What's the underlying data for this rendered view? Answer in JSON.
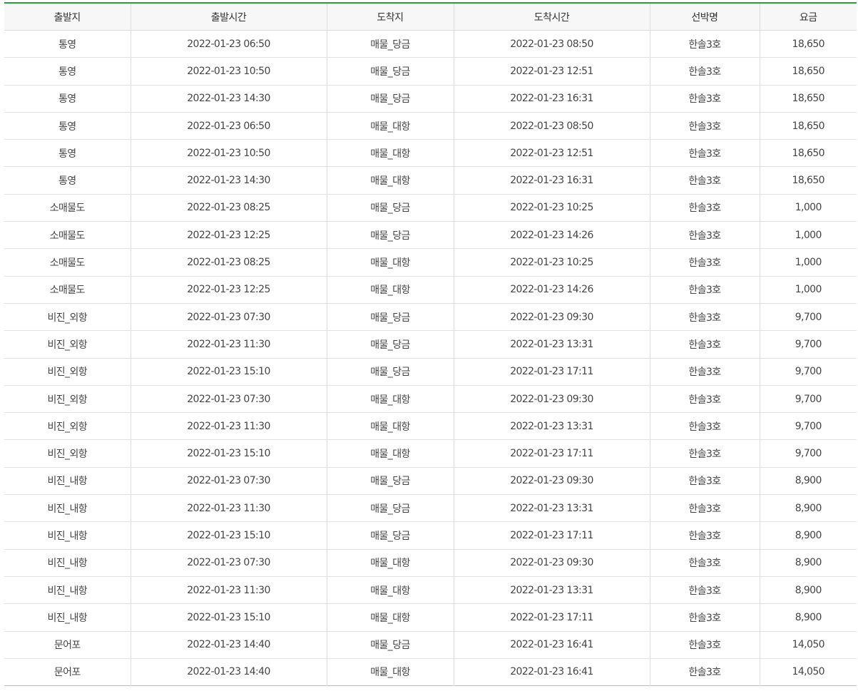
{
  "colors": {
    "accent_top_border": "#2e9b3c",
    "header_background": "#f7f7f7",
    "grid_line": "#dcdcdc"
  },
  "table": {
    "headers": [
      "출발지",
      "출발시간",
      "도착지",
      "도착시간",
      "선박명",
      "요금"
    ],
    "rows": [
      [
        "통영",
        "2022-01-23 06:50",
        "매물_당금",
        "2022-01-23 08:50",
        "한솔3호",
        "18,650"
      ],
      [
        "통영",
        "2022-01-23 10:50",
        "매물_당금",
        "2022-01-23 12:51",
        "한솔3호",
        "18,650"
      ],
      [
        "통영",
        "2022-01-23 14:30",
        "매물_당금",
        "2022-01-23 16:31",
        "한솔3호",
        "18,650"
      ],
      [
        "통영",
        "2022-01-23 06:50",
        "매물_대항",
        "2022-01-23 08:50",
        "한솔3호",
        "18,650"
      ],
      [
        "통영",
        "2022-01-23 10:50",
        "매물_대항",
        "2022-01-23 12:51",
        "한솔3호",
        "18,650"
      ],
      [
        "통영",
        "2022-01-23 14:30",
        "매물_대항",
        "2022-01-23 16:31",
        "한솔3호",
        "18,650"
      ],
      [
        "소매물도",
        "2022-01-23 08:25",
        "매물_당금",
        "2022-01-23 10:25",
        "한솔3호",
        "1,000"
      ],
      [
        "소매물도",
        "2022-01-23 12:25",
        "매물_당금",
        "2022-01-23 14:26",
        "한솔3호",
        "1,000"
      ],
      [
        "소매물도",
        "2022-01-23 08:25",
        "매물_대항",
        "2022-01-23 10:25",
        "한솔3호",
        "1,000"
      ],
      [
        "소매물도",
        "2022-01-23 12:25",
        "매물_대항",
        "2022-01-23 14:26",
        "한솔3호",
        "1,000"
      ],
      [
        "비진_외항",
        "2022-01-23 07:30",
        "매물_당금",
        "2022-01-23 09:30",
        "한솔3호",
        "9,700"
      ],
      [
        "비진_외항",
        "2022-01-23 11:30",
        "매물_당금",
        "2022-01-23 13:31",
        "한솔3호",
        "9,700"
      ],
      [
        "비진_외항",
        "2022-01-23 15:10",
        "매물_당금",
        "2022-01-23 17:11",
        "한솔3호",
        "9,700"
      ],
      [
        "비진_외항",
        "2022-01-23 07:30",
        "매물_대항",
        "2022-01-23 09:30",
        "한솔3호",
        "9,700"
      ],
      [
        "비진_외항",
        "2022-01-23 11:30",
        "매물_대항",
        "2022-01-23 13:31",
        "한솔3호",
        "9,700"
      ],
      [
        "비진_외항",
        "2022-01-23 15:10",
        "매물_대항",
        "2022-01-23 17:11",
        "한솔3호",
        "9,700"
      ],
      [
        "비진_내항",
        "2022-01-23 07:30",
        "매물_당금",
        "2022-01-23 09:30",
        "한솔3호",
        "8,900"
      ],
      [
        "비진_내항",
        "2022-01-23 11:30",
        "매물_당금",
        "2022-01-23 13:31",
        "한솔3호",
        "8,900"
      ],
      [
        "비진_내항",
        "2022-01-23 15:10",
        "매물_당금",
        "2022-01-23 17:11",
        "한솔3호",
        "8,900"
      ],
      [
        "비진_내항",
        "2022-01-23 07:30",
        "매물_대항",
        "2022-01-23 09:30",
        "한솔3호",
        "8,900"
      ],
      [
        "비진_내항",
        "2022-01-23 11:30",
        "매물_대항",
        "2022-01-23 13:31",
        "한솔3호",
        "8,900"
      ],
      [
        "비진_내항",
        "2022-01-23 15:10",
        "매물_대항",
        "2022-01-23 17:11",
        "한솔3호",
        "8,900"
      ],
      [
        "문어포",
        "2022-01-23 14:40",
        "매물_당금",
        "2022-01-23 16:41",
        "한솔3호",
        "14,050"
      ],
      [
        "문어포",
        "2022-01-23 14:40",
        "매물_대항",
        "2022-01-23 16:41",
        "한솔3호",
        "14,050"
      ]
    ]
  }
}
